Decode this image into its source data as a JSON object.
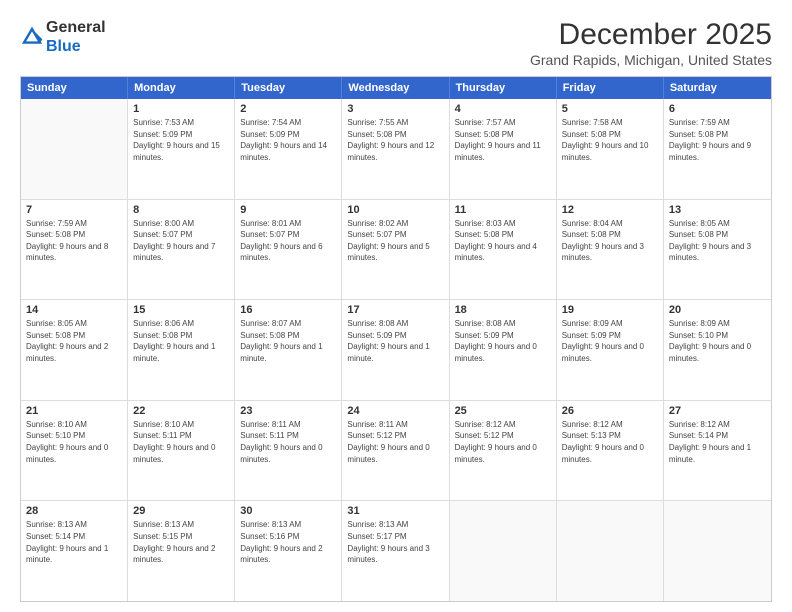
{
  "logo": {
    "general": "General",
    "blue": "Blue"
  },
  "title": "December 2025",
  "subtitle": "Grand Rapids, Michigan, United States",
  "headers": [
    "Sunday",
    "Monday",
    "Tuesday",
    "Wednesday",
    "Thursday",
    "Friday",
    "Saturday"
  ],
  "weeks": [
    [
      {
        "day": "",
        "empty": true
      },
      {
        "day": "1",
        "sunrise": "7:53 AM",
        "sunset": "5:09 PM",
        "daylight": "9 hours and 15 minutes."
      },
      {
        "day": "2",
        "sunrise": "7:54 AM",
        "sunset": "5:09 PM",
        "daylight": "9 hours and 14 minutes."
      },
      {
        "day": "3",
        "sunrise": "7:55 AM",
        "sunset": "5:08 PM",
        "daylight": "9 hours and 12 minutes."
      },
      {
        "day": "4",
        "sunrise": "7:57 AM",
        "sunset": "5:08 PM",
        "daylight": "9 hours and 11 minutes."
      },
      {
        "day": "5",
        "sunrise": "7:58 AM",
        "sunset": "5:08 PM",
        "daylight": "9 hours and 10 minutes."
      },
      {
        "day": "6",
        "sunrise": "7:59 AM",
        "sunset": "5:08 PM",
        "daylight": "9 hours and 9 minutes."
      }
    ],
    [
      {
        "day": "7",
        "sunrise": "7:59 AM",
        "sunset": "5:08 PM",
        "daylight": "9 hours and 8 minutes."
      },
      {
        "day": "8",
        "sunrise": "8:00 AM",
        "sunset": "5:07 PM",
        "daylight": "9 hours and 7 minutes."
      },
      {
        "day": "9",
        "sunrise": "8:01 AM",
        "sunset": "5:07 PM",
        "daylight": "9 hours and 6 minutes."
      },
      {
        "day": "10",
        "sunrise": "8:02 AM",
        "sunset": "5:07 PM",
        "daylight": "9 hours and 5 minutes."
      },
      {
        "day": "11",
        "sunrise": "8:03 AM",
        "sunset": "5:08 PM",
        "daylight": "9 hours and 4 minutes."
      },
      {
        "day": "12",
        "sunrise": "8:04 AM",
        "sunset": "5:08 PM",
        "daylight": "9 hours and 3 minutes."
      },
      {
        "day": "13",
        "sunrise": "8:05 AM",
        "sunset": "5:08 PM",
        "daylight": "9 hours and 3 minutes."
      }
    ],
    [
      {
        "day": "14",
        "sunrise": "8:05 AM",
        "sunset": "5:08 PM",
        "daylight": "9 hours and 2 minutes."
      },
      {
        "day": "15",
        "sunrise": "8:06 AM",
        "sunset": "5:08 PM",
        "daylight": "9 hours and 1 minute."
      },
      {
        "day": "16",
        "sunrise": "8:07 AM",
        "sunset": "5:08 PM",
        "daylight": "9 hours and 1 minute."
      },
      {
        "day": "17",
        "sunrise": "8:08 AM",
        "sunset": "5:09 PM",
        "daylight": "9 hours and 1 minute."
      },
      {
        "day": "18",
        "sunrise": "8:08 AM",
        "sunset": "5:09 PM",
        "daylight": "9 hours and 0 minutes."
      },
      {
        "day": "19",
        "sunrise": "8:09 AM",
        "sunset": "5:09 PM",
        "daylight": "9 hours and 0 minutes."
      },
      {
        "day": "20",
        "sunrise": "8:09 AM",
        "sunset": "5:10 PM",
        "daylight": "9 hours and 0 minutes."
      }
    ],
    [
      {
        "day": "21",
        "sunrise": "8:10 AM",
        "sunset": "5:10 PM",
        "daylight": "9 hours and 0 minutes."
      },
      {
        "day": "22",
        "sunrise": "8:10 AM",
        "sunset": "5:11 PM",
        "daylight": "9 hours and 0 minutes."
      },
      {
        "day": "23",
        "sunrise": "8:11 AM",
        "sunset": "5:11 PM",
        "daylight": "9 hours and 0 minutes."
      },
      {
        "day": "24",
        "sunrise": "8:11 AM",
        "sunset": "5:12 PM",
        "daylight": "9 hours and 0 minutes."
      },
      {
        "day": "25",
        "sunrise": "8:12 AM",
        "sunset": "5:12 PM",
        "daylight": "9 hours and 0 minutes."
      },
      {
        "day": "26",
        "sunrise": "8:12 AM",
        "sunset": "5:13 PM",
        "daylight": "9 hours and 0 minutes."
      },
      {
        "day": "27",
        "sunrise": "8:12 AM",
        "sunset": "5:14 PM",
        "daylight": "9 hours and 1 minute."
      }
    ],
    [
      {
        "day": "28",
        "sunrise": "8:13 AM",
        "sunset": "5:14 PM",
        "daylight": "9 hours and 1 minute."
      },
      {
        "day": "29",
        "sunrise": "8:13 AM",
        "sunset": "5:15 PM",
        "daylight": "9 hours and 2 minutes."
      },
      {
        "day": "30",
        "sunrise": "8:13 AM",
        "sunset": "5:16 PM",
        "daylight": "9 hours and 2 minutes."
      },
      {
        "day": "31",
        "sunrise": "8:13 AM",
        "sunset": "5:17 PM",
        "daylight": "9 hours and 3 minutes."
      },
      {
        "day": "",
        "empty": true
      },
      {
        "day": "",
        "empty": true
      },
      {
        "day": "",
        "empty": true
      }
    ]
  ]
}
